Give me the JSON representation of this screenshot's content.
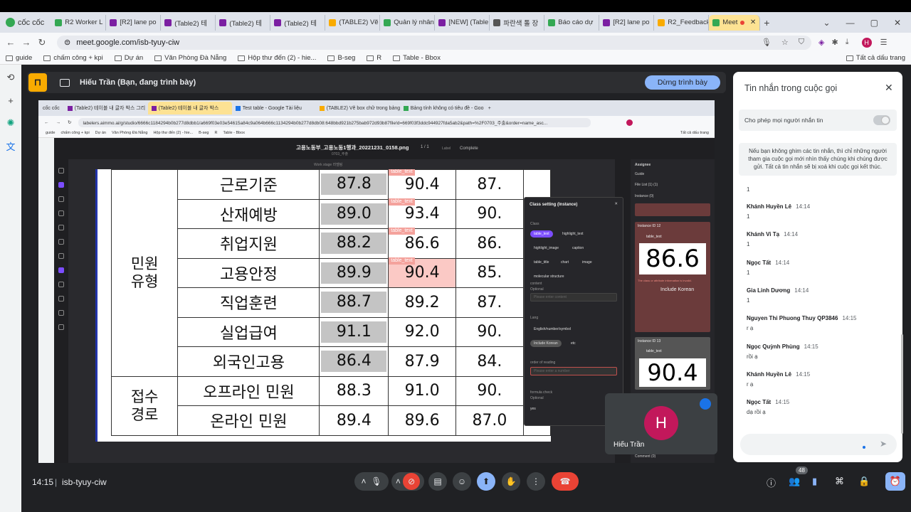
{
  "browser": {
    "brand": "cốc cốc",
    "tabs": [
      {
        "label": "R2 Worker L",
        "color": "#34a853"
      },
      {
        "label": "[R2] lane po",
        "color": "#7b1fa2"
      },
      {
        "label": "(Table2) 테",
        "color": "#7b1fa2"
      },
      {
        "label": "(Table2) 테",
        "color": "#7b1fa2"
      },
      {
        "label": "(Table2) 테",
        "color": "#7b1fa2"
      },
      {
        "label": "(TABLE2) Vẽ",
        "color": "#f9ab00"
      },
      {
        "label": "Quản lý nhân",
        "color": "#34a853"
      },
      {
        "label": "[NEW] (Table",
        "color": "#7b1fa2"
      },
      {
        "label": "파란색 톨 장",
        "color": "#555555"
      },
      {
        "label": "Báo cáo dự",
        "color": "#34a853"
      },
      {
        "label": "[R2] lane po",
        "color": "#7b1fa2"
      },
      {
        "label": "R2_Feedback",
        "color": "#f9ab00"
      }
    ],
    "active_tab": "Meet",
    "url": "meet.google.com/isb-tyuy-ciw",
    "profile_initial": "H",
    "bookmarks": [
      "guide",
      "chấm công + kpi",
      "Dự án",
      "Văn Phòng Đà Nẵng",
      "Hộp thư đến (2) - hie...",
      "B-seg",
      "R",
      "Table - Bbox"
    ],
    "bookmarks_right": "Tất cả dấu trang"
  },
  "present_bar": {
    "title": "Hiếu Trần (Bạn, đang trình bày)",
    "stop_label": "Dừng trình bày"
  },
  "shared": {
    "tabs": [
      "(Table2) 테이블 내 글자 박스 그리",
      "(Table2) 테이블 내 글자 박스",
      "Test table - Google Tài liệu",
      "(TABLE2) Vẽ box chữ trong bảng...",
      "Bảng tính không có tiêu đề - Goo"
    ],
    "url": "labelers.aimmo.ai/g/studio/6666c1184294b0b277d8dbb1/a669f03e03e54615a84c9a064b666c1134294b0b277d8db08:648bbd921b275bab972d93b87file!d=669f03f3ddc944927fda5ab2&path=%2F0703_주출&order=name_asc...",
    "bookmarks": [
      "guide",
      "chấm công + kpi",
      "Dự án",
      "Văn Phòng Đà Nẵng",
      "Hộp thư đến (2) - hie...",
      "B-seg",
      "R",
      "Table - Bbox"
    ],
    "bookmarks_right": "Tất cả dấu trang",
    "filename": "고용노동부_고용노동1행과_20221231_0158.png",
    "sub": "0703_주출",
    "page": "1 / 1",
    "label": "Label",
    "status": "Complete",
    "work_stage": "Work stage",
    "work_stage_val": "라벨링",
    "table": {
      "groups": [
        {
          "name": "민원\n유형",
          "rows": 7
        },
        {
          "name": "접수\n경로",
          "rows": 2
        }
      ],
      "rows": [
        {
          "label": "근로기준",
          "c1": "87.8",
          "c2": "90.4",
          "c3": "87.",
          "c4": "",
          "tag": "table_text"
        },
        {
          "label": "산재예방",
          "c1": "89.0",
          "c2": "93.4",
          "c3": "90.",
          "c4": "",
          "tag": "table_text"
        },
        {
          "label": "취업지원",
          "c1": "88.2",
          "c2": "86.6",
          "c3": "86.",
          "c4": "",
          "tag": "table_text"
        },
        {
          "label": "고용안정",
          "c1": "89.9",
          "c2": "90.4",
          "c3": "85.",
          "c4": "",
          "tag": "table_text"
        },
        {
          "label": "직업훈련",
          "c1": "88.7",
          "c2": "89.2",
          "c3": "87.",
          "c4": "",
          "tag": ""
        },
        {
          "label": "실업급여",
          "c1": "91.1",
          "c2": "92.0",
          "c3": "90.",
          "c4": "",
          "tag": ""
        },
        {
          "label": "외국인고용",
          "c1": "86.4",
          "c2": "87.9",
          "c3": "84.",
          "c4": "",
          "tag": ""
        },
        {
          "label": "오프라인 민원",
          "c1": "88.3",
          "c2": "91.0",
          "c3": "90.",
          "c4": "",
          "tag": ""
        },
        {
          "label": "온라인 민원",
          "c1": "89.4",
          "c2": "89.6",
          "c3": "87.0",
          "c4": "",
          "tag": ""
        }
      ]
    },
    "class_panel": {
      "title": "Class setting (Instance)",
      "class_label": "Class",
      "classes": [
        "table_text",
        "highlight_text",
        "highlight_image",
        "caption",
        "table_title",
        "chart",
        "image",
        "molecular structure"
      ],
      "content_label": "content",
      "content_sub": "Optional",
      "content_placeholder": "Please enter content",
      "lang_label": "Lang",
      "langs": [
        "English/number/symbol",
        "Include Korean",
        "etc"
      ],
      "order_label": "order of reading",
      "order_placeholder": "Please enter a number",
      "formula_label": "formula check",
      "formula_sub": "Optional",
      "formula_val": "yes"
    },
    "right_panel": {
      "assignee": "Assignee",
      "guide": "Guide",
      "file_list": "File List (1) (1)",
      "instance": "Instance (0)",
      "inst12_label": "Instance ID 12",
      "inst12_value": "86.6",
      "inst12_tag": "table_text",
      "inst12_warn": "The class or attribute information is invalid.",
      "inst12_lang": "Include Korean",
      "inst13_label": "Instance ID 13",
      "inst13_value": "90.4",
      "inst13_tag": "table_text",
      "comment": "Comment (0)"
    },
    "floating_tag": "table_text"
  },
  "self_tile": {
    "initial": "H",
    "name": "Hiếu Trần"
  },
  "bottom": {
    "time": "14:15",
    "code": "isb-tyuy-ciw",
    "participants": "48"
  },
  "chat": {
    "title": "Tin nhắn trong cuộc gọi",
    "allow": "Cho phép mọi người nhắn tin",
    "notice": "Nếu bạn không ghim các tin nhắn, thì chỉ những người tham gia cuộc gọi mới nhìn thấy chúng khi chúng được gửi. Tất cả tin nhắn sẽ bị xoá khi cuộc gọi kết thúc.",
    "first": "1",
    "messages": [
      {
        "name": "Khánh Huyền Lê",
        "time": "14:14",
        "text": "1"
      },
      {
        "name": "Khánh Vi Tạ",
        "time": "14:14",
        "text": "1"
      },
      {
        "name": "Ngọc Tất",
        "time": "14:14",
        "text": "1"
      },
      {
        "name": "Gia Linh Dương",
        "time": "14:14",
        "text": "1"
      },
      {
        "name": "Nguyen Thi Phuong Thuy QP3846",
        "time": "14:15",
        "text": "r ạ"
      },
      {
        "name": "Ngọc Quỳnh Phùng",
        "time": "14:15",
        "text": "rồi ạ"
      },
      {
        "name": "Khánh Huyền Lê",
        "time": "14:15",
        "text": "r ạ"
      },
      {
        "name": "Ngọc Tất",
        "time": "14:15",
        "text": "dạ rồi ạ"
      }
    ]
  },
  "colors": {
    "accent": "#8ab4f8",
    "end_call": "#ea4335",
    "present_logo": "#f9ab00",
    "avatar": "#c2185b",
    "selected_class": "#7c4dff"
  }
}
